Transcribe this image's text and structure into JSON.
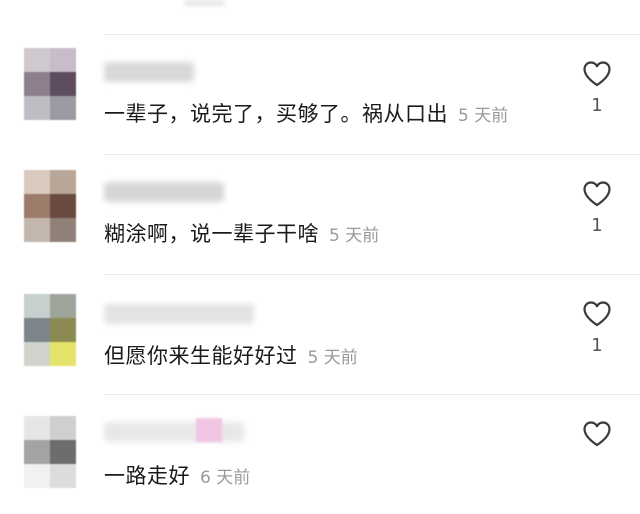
{
  "comments": [
    {
      "text": "一辈子，说完了，买够了。祸从口出",
      "time": "5 天前",
      "likes": "1",
      "avatar_colors": [
        "#cfc8cf",
        "#c8bccb",
        "#8d7f8d",
        "#5e4c5f",
        "#bfbcc3",
        "#9b9aa2"
      ],
      "name_blur_color": "#d9d9d9"
    },
    {
      "text": "糊涂啊，说一辈子干啥",
      "time": "5 天前",
      "likes": "1",
      "avatar_colors": [
        "#d9c9be",
        "#b8a698",
        "#9c7b6b",
        "#6a4a40",
        "#c3b6ad",
        "#8f8078"
      ],
      "name_blur_color": "#d5d5d5"
    },
    {
      "text": "但愿你来生能好好过",
      "time": "5 天前",
      "likes": "1",
      "avatar_colors": [
        "#c7cfcf",
        "#9ea59a",
        "#7d858a",
        "#8b8a52",
        "#cfd3cb",
        "#e4e36a"
      ],
      "name_blur_color": "#e3e3e3"
    },
    {
      "text": "一路走好",
      "time": "6 天前",
      "likes": "",
      "avatar_colors": [
        "#e6e6e6",
        "#cfcfcf",
        "#a3a3a3",
        "#6d6d6d",
        "#f1f1f1",
        "#dcdcdc"
      ],
      "name_blur_color": "#e8e8e8"
    }
  ]
}
